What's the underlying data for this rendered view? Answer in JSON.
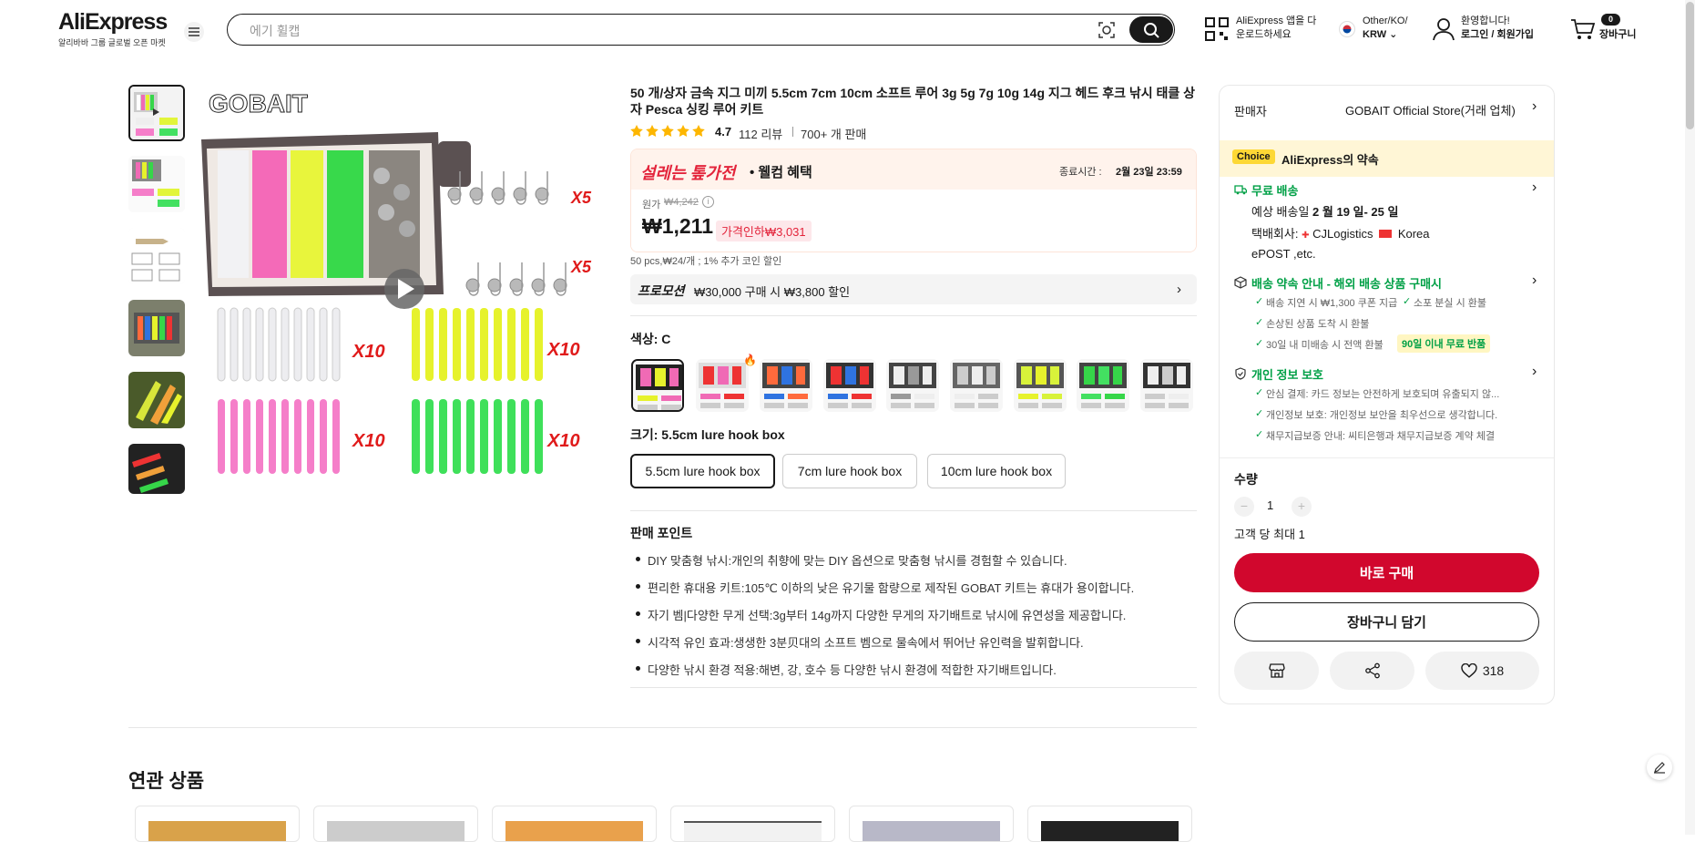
{
  "header": {
    "logo": "AliExpress",
    "logo_sub": "알리바바 그룹 글로벌 오픈 마켓",
    "search_placeholder": "에기 휠캡",
    "app_line1": "AliExpress 앱을 다",
    "app_line2": "운로드하세요",
    "locale_line1": "Other/KO/",
    "locale_line2": "KRW",
    "account_line1": "환영합니다!",
    "account_line2": "로그인 / 회원가입",
    "cart_count": "0",
    "cart_label": "장바구니"
  },
  "product": {
    "title": "50 개/상자 금속 지그 미끼 5.5cm 7cm 10cm 소프트 루어 3g 5g 7g 10g 14g 지그 헤드 후크 낚시 태클 상자 Pesca 싱킹 루어 키트",
    "rating": "4.7",
    "reviews": "112 리뷰",
    "sold": "700+ 개 판매",
    "stars": 4.7,
    "brand_on_image": "GOBAIT",
    "image_labels": [
      "X5",
      "X5",
      "X10",
      "X10",
      "X10",
      "X10"
    ]
  },
  "promo": {
    "event_name": "설레는 톺가전",
    "event_sub": "• 웰컴 혜택",
    "end_label": "종료시간 :",
    "end_time": "2월 23일 23:59",
    "original_label": "원가",
    "original_price": "₩4,242",
    "price": "₩1,211",
    "discount": "가격인하₩3,031"
  },
  "coin_note": "50 pcs,₩24/개 ; 1% 추가 코인 할인",
  "promotion_bar": {
    "label": "프로모션",
    "text": "₩30,000 구매 시 ₩3,800 할인"
  },
  "color": {
    "label": "색상: C",
    "count": 9
  },
  "size": {
    "label": "크기: 5.5cm lure hook box",
    "options": [
      "5.5cm lure hook box",
      "7cm lure hook box",
      "10cm lure hook box"
    ]
  },
  "selling_points": {
    "heading": "판매 포인트",
    "items": [
      "DIY 맞춤형 낚시:개인의 취향에 맞는 DIY 옵션으로 맞춤형 낚시를 경험할 수 있습니다.",
      "편리한 휴대용 키트:105℃ 이하의 낮은 유기물 함량으로 제작된 GOBAT 키트는 휴대가 용이합니다.",
      "자기 벰|다양한 무게 선택:3g부터 14g까지 다양한 무게의 자기배트로 낚시에 유연성을 제공합니다.",
      "시각적 유인 효과:생생한 3분贝대의 소프트 벰으로 물속에서 뛰어난 유인력을 발휘합니다.",
      "다양한 낚시 환경 적용:해변, 강, 호수 등 다양한 낚시 환경에 적합한 자기배트입니다."
    ]
  },
  "related": {
    "heading": "연관 상품"
  },
  "panel": {
    "seller_label": "판매자",
    "seller_name": "GOBAIT Official Store(거래 업체)",
    "choice_badge": "Choice",
    "promise": "AliExpress의 약속",
    "shipping_title": "무료 배송",
    "delivery_prefix": "예상 배송일",
    "delivery_date": "2 월 19 일- 25 일",
    "carrier_label": "택배회사:",
    "carrier1": "CJLogistics",
    "carrier2": "Korea",
    "carrier3": "ePOST ,etc.",
    "guarantee_title": "배송 약속 안내 - 해외 배송 상품 구매시",
    "guarantee_items": [
      "배송 지연 시 ₩1,300 쿠폰 지급",
      "소포 분실 시 환불",
      "손상된 상품 도착 시 환불",
      "30일 내 미배송 시 전액 환불"
    ],
    "free_return": "90일 이내 무료 반품",
    "privacy_title": "개인 정보 보호",
    "privacy_items": [
      "안심 결제: 카드 정보는 안전하게 보호되며 유출되지 않...",
      "개인정보 보호: 개인정보 보안을 최우선으로 생각합니다.",
      "채무지급보증 안내: 씨티은행과 채무지급보증 계약 체결"
    ],
    "qty_label": "수량",
    "qty_value": "1",
    "limit": "고객 당 최대 1",
    "buy_now": "바로 구매",
    "add_cart": "장바구니 담기",
    "wish_count": "318"
  },
  "colors": {
    "brand_red": "#d1072d",
    "green": "#00a046",
    "promo_red": "#e3243b"
  }
}
